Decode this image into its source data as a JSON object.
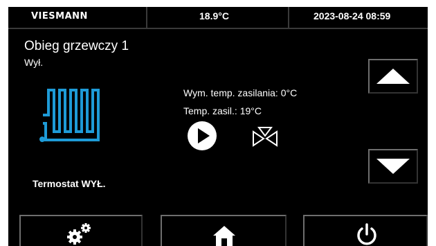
{
  "header": {
    "brand": "VIESMANN",
    "temperature": "18.9°C",
    "datetime": "2023-08-24 08:59"
  },
  "circuit": {
    "title": "Obieg grzewczy 1",
    "status": "Wył."
  },
  "info": {
    "flow_temp_required": "Wym. temp. zasilania: 0°C",
    "flow_temp": "Temp. zasil.: 19°C"
  },
  "thermostat": {
    "label": "Termostat WYŁ."
  },
  "icons": {
    "heating": "underfloor-heating-icon",
    "pump": "pump-play-icon",
    "valve": "mixing-valve-icon",
    "up": "arrow-up-icon",
    "down": "arrow-down-icon",
    "settings": "gears-icon",
    "home": "home-icon",
    "power": "power-icon"
  },
  "colors": {
    "background": "#000000",
    "text": "#ffffff",
    "accent": "#1e9bd7"
  }
}
